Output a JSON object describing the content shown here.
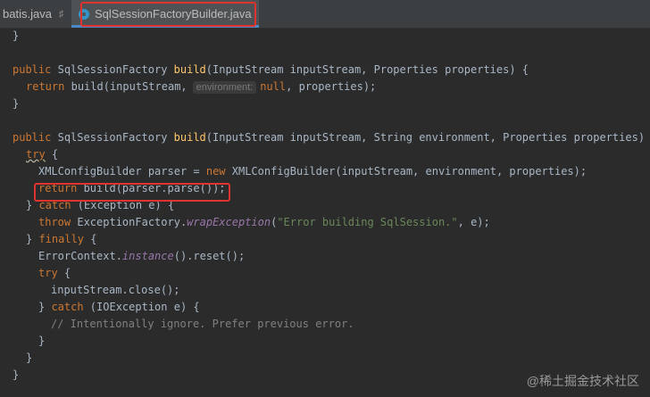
{
  "tabs": [
    {
      "label": "batis.java",
      "pinned": true
    },
    {
      "label": "SqlSessionFactoryBuilder.java",
      "active": true
    }
  ],
  "code": {
    "l1": "}",
    "l2_public": "public",
    "l2_type": "SqlSessionFactory",
    "l2_fn": "build",
    "l2_rest": "(InputStream inputStream, Properties properties) {",
    "l3_return": "return",
    "l3_fn": "build",
    "l3_a": "(inputStream,",
    "l3_hint": "environment:",
    "l3_null": "null",
    "l3_b": ", properties);",
    "l4": "}",
    "l5_public": "public",
    "l5_type": "SqlSessionFactory",
    "l5_fn": "build",
    "l5_rest": "(InputStream inputStream, String environment, Properties properties) {",
    "l6_try": "try",
    "l6_b": " {",
    "l7_a": "XMLConfigBuilder parser = ",
    "l7_new": "new",
    "l7_b": " XMLConfigBuilder(inputStream, environment, properties);",
    "l8_return": "return",
    "l8_b": " build(parser.parse());",
    "l9_a": "} ",
    "l9_catch": "catch",
    "l9_b": " (Exception e) {",
    "l10_throw": "throw",
    "l10_a": " ExceptionFactory.",
    "l10_it": "wrapException",
    "l10_b": "(",
    "l10_str": "\"Error building SqlSession.\"",
    "l10_c": ", e);",
    "l11_a": "} ",
    "l11_finally": "finally",
    "l11_b": " {",
    "l12_a": "ErrorContext.",
    "l12_it": "instance",
    "l12_b": "().reset();",
    "l13_try": "try",
    "l13_b": " {",
    "l14": "inputStream.close();",
    "l15_a": "} ",
    "l15_catch": "catch",
    "l15_b": " (IOException e) {",
    "l16": "// Intentionally ignore. Prefer previous error.",
    "l17": "}",
    "l18": "}",
    "l19": "}"
  },
  "watermark": "@稀土掘金技术社区",
  "colors": {
    "keyword": "#cc7832",
    "function": "#ffc66d",
    "string": "#6a8759",
    "comment": "#808080",
    "static": "#9876aa",
    "highlight": "#e0322f"
  }
}
